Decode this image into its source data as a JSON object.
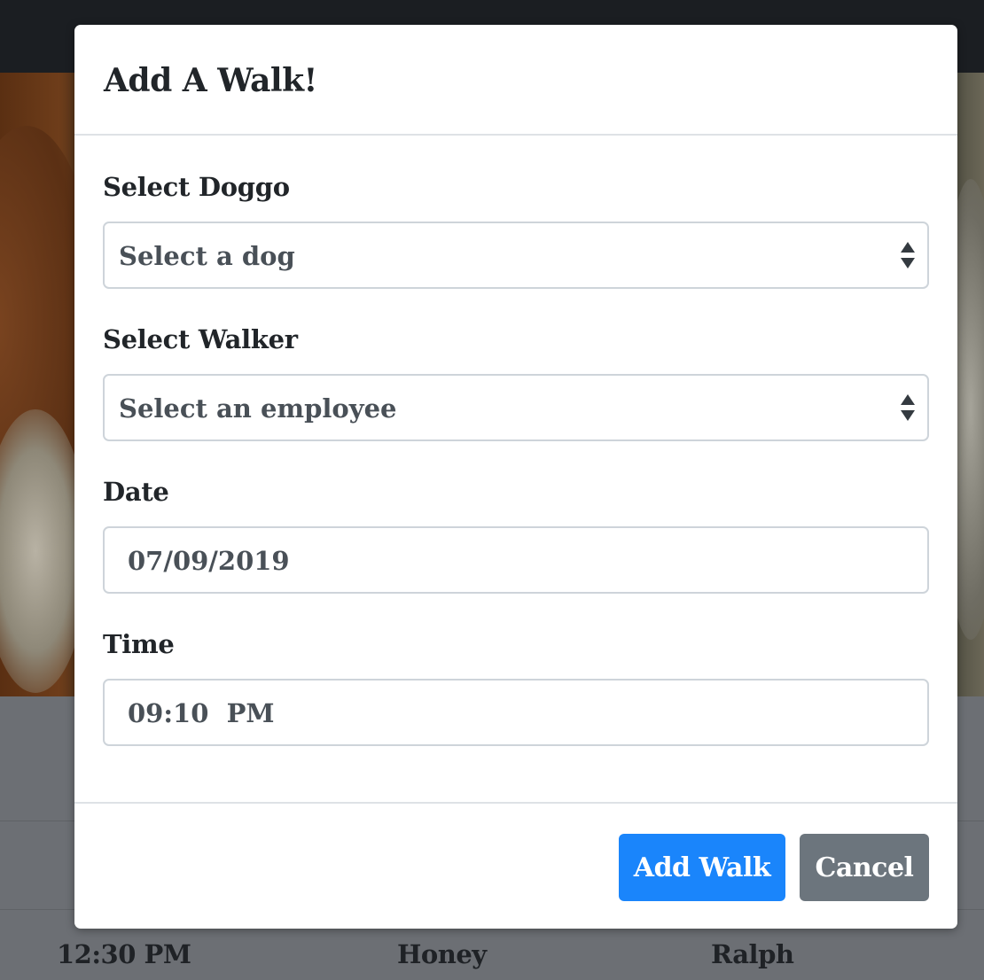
{
  "background": {
    "table_row": {
      "time": "12:30 PM",
      "dog": "Honey",
      "walker": "Ralph"
    }
  },
  "modal": {
    "title": "Add A Walk!",
    "fields": {
      "dog": {
        "label": "Select Doggo",
        "value": "Select a dog"
      },
      "walker": {
        "label": "Select Walker",
        "value": "Select an employee"
      },
      "date": {
        "label": "Date",
        "value": "07/09/2019"
      },
      "time": {
        "label": "Time",
        "value": "09:10  PM"
      }
    },
    "buttons": {
      "add": "Add Walk",
      "cancel": "Cancel"
    }
  },
  "colors": {
    "primary": "#1a85fb",
    "secondary": "#6c757d",
    "overlay": "#6c6f74"
  },
  "icons": {
    "select_caret": "up-down-caret-icon"
  }
}
